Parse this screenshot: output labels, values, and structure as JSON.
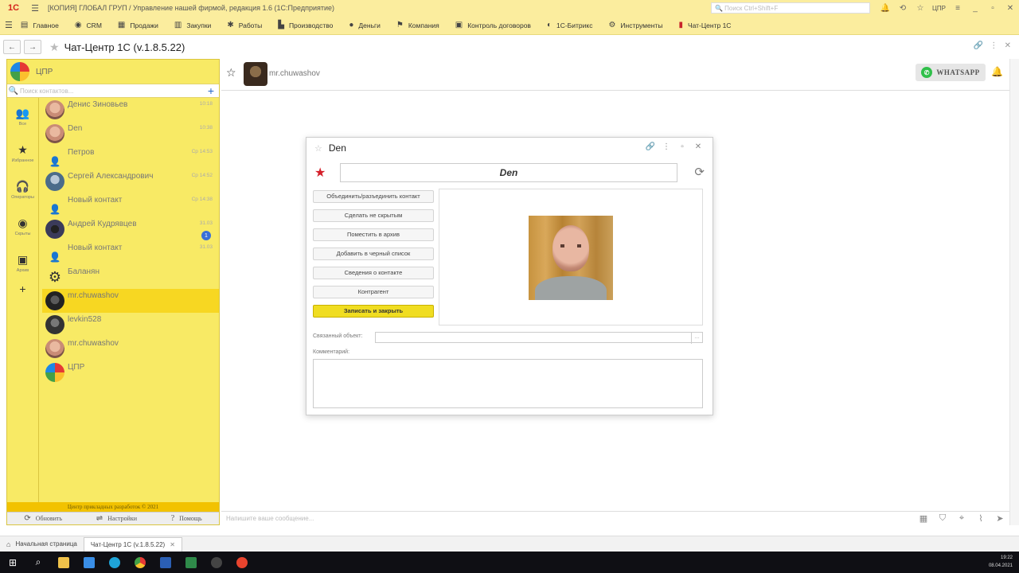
{
  "titlebar": {
    "logo": "1С",
    "title": "[КОПИЯ] ГЛОБАЛ ГРУП / Управление нашей фирмой, редакция 1.6  (1С:Предприятие)",
    "search_placeholder": "Поиск Ctrl+Shift+F",
    "user": "ЦПР"
  },
  "sections": [
    {
      "label": "Главное",
      "icon": "home-icon"
    },
    {
      "label": "CRM",
      "icon": "crm-icon"
    },
    {
      "label": "Продажи",
      "icon": "cart-icon"
    },
    {
      "label": "Закупки",
      "icon": "truck-icon"
    },
    {
      "label": "Работы",
      "icon": "tools-icon"
    },
    {
      "label": "Производство",
      "icon": "factory-icon"
    },
    {
      "label": "Деньги",
      "icon": "money-icon"
    },
    {
      "label": "Компания",
      "icon": "flag-icon"
    },
    {
      "label": "Контроль договоров",
      "icon": "contract-icon"
    },
    {
      "label": "1С-Битрикс",
      "icon": "bitrix-icon"
    },
    {
      "label": "Инструменты",
      "icon": "instruments-icon"
    },
    {
      "label": "Чат-Центр 1С",
      "icon": "chat-icon"
    }
  ],
  "form": {
    "title": "Чат-Центр 1С  (v.1.8.5.22)"
  },
  "left": {
    "org_name": "ЦПР",
    "search_placeholder": "Поиск контактов...",
    "side": [
      {
        "label": "Все",
        "icon": "people-icon"
      },
      {
        "label": "Избранное",
        "icon": "star-icon"
      },
      {
        "label": "Операторы",
        "icon": "headset-icon"
      },
      {
        "label": "Скрыты",
        "icon": "eye-icon"
      },
      {
        "label": "Архив",
        "icon": "archive-icon"
      }
    ],
    "contacts": [
      {
        "name": "Денис Зиновьев",
        "time": "10:18",
        "avatar": "face"
      },
      {
        "name": "Den",
        "time": "10:38",
        "avatar": "face"
      },
      {
        "name": "Петров",
        "time": "Ср 14:53",
        "avatar": "person"
      },
      {
        "name": "Сергей Александрович",
        "time": "Ср 14:52",
        "avatar": "blue"
      },
      {
        "name": "Новый контакт",
        "time": "Ср 14:38",
        "avatar": "person"
      },
      {
        "name": "Андрей Кудрявцев",
        "time": "31.03",
        "avatar": "star",
        "badge": "1"
      },
      {
        "name": "Новый контакт",
        "time": "31.03",
        "avatar": "person"
      },
      {
        "name": "Баланян",
        "time": "",
        "avatar": "gear"
      },
      {
        "name": "mr.chuwashov",
        "time": "",
        "avatar": "dark",
        "selected": true
      },
      {
        "name": "levkin528",
        "time": "",
        "avatar": "gray"
      },
      {
        "name": "mr.chuwashov",
        "time": "",
        "avatar": "face"
      },
      {
        "name": "ЦПР",
        "time": "",
        "avatar": "logo"
      }
    ],
    "footer_text": "Центр прикладных разработок © 2021",
    "refresh_label": "Обновить",
    "settings_label": "Настройки",
    "help_label": "Помощь"
  },
  "chat": {
    "contact_name": "mr.chuwashov",
    "whatsapp_label": "WHATSAPP",
    "message_placeholder": "Напишите ваше сообщение..."
  },
  "modal": {
    "title": "Den",
    "name_value": "Den",
    "buttons": [
      "Объединить/разъединить контакт",
      "Сделать не скрытым",
      "Поместить в архив",
      "Добавить в черный список",
      "Сведения о контакте",
      "Контрагент",
      "Записать и закрыть"
    ],
    "linked_label": "Связанный объект:",
    "comment_label": "Комментарий:"
  },
  "tabs": {
    "home": "Начальная страница",
    "chat": "Чат-Центр 1С  (v.1.8.5.22)"
  },
  "taskbar": {
    "time": "19:22",
    "date": "08.04.2021"
  }
}
